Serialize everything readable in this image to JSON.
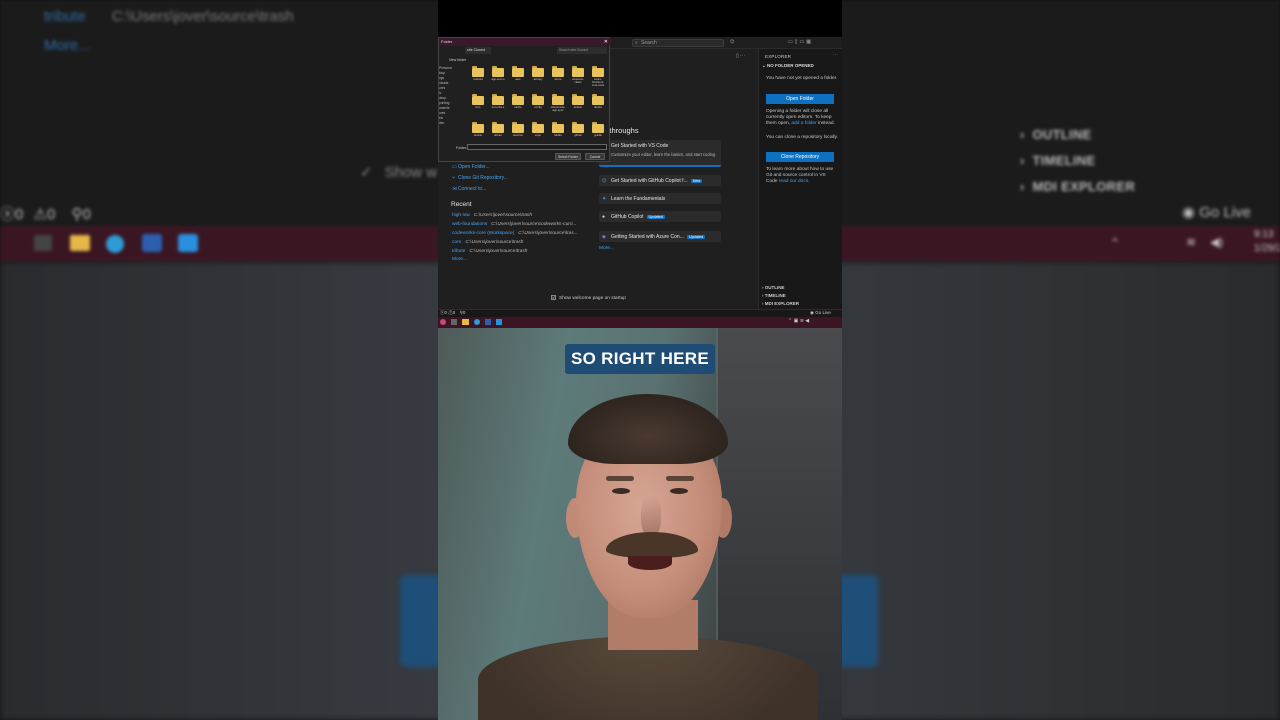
{
  "background": {
    "recent_name": "tribute",
    "recent_path": "C:\\Users\\jover\\source\\trash",
    "more": "More...",
    "show_welcome": "Show w",
    "outline": "OUTLINE",
    "timeline": "TIMELINE",
    "mdi_explorer": "MDI EXPLORER",
    "go_live": "Go Live",
    "errors": "0",
    "warnings": "0",
    "ports": "0",
    "clock_time": "9:13",
    "clock_date": "1/29/2"
  },
  "vscode": {
    "search_placeholder": "Search",
    "explorer_title": "EXPLORER",
    "no_folder": "NO FOLDER OPENED",
    "no_folder_msg": "You have not yet opened a folder.",
    "open_folder_btn": "Open Folder",
    "opening_msg": "Opening a folder will close all currently open editors. To keep them open,",
    "add_folder_link": "add a folder",
    "instead": "instead.",
    "clone_msg": "You can clone a repository locally.",
    "clone_btn": "Clone Repository",
    "learn_msg": "To learn more about how to use Git and source control in VS Code",
    "read_docs": "read our docs.",
    "outline": "OUTLINE",
    "timeline": "TIMELINE",
    "mdi_explorer": "MDI EXPLORER",
    "status_errors": "0",
    "status_warnings": "0",
    "status_ports": "0",
    "go_live": "Go Live"
  },
  "welcome": {
    "start_items": [
      {
        "label": "Open Folder..."
      },
      {
        "label": "Clone Git Repository..."
      },
      {
        "label": "Connect to..."
      }
    ],
    "recent_title": "Recent",
    "recent": [
      {
        "name": "high-low",
        "path": "C:\\Users\\jover\\source\\trash"
      },
      {
        "name": "web-foundations",
        "path": "C:\\Users\\jover\\source\\codeworks-curri..."
      },
      {
        "name": "codeworks-core (Workspace)",
        "path": "C:\\Users\\jover\\source\\tras..."
      },
      {
        "name": "core",
        "path": "C:\\Users\\jover\\source\\trash"
      },
      {
        "name": "tribute",
        "path": "C:\\Users\\jover\\source\\trash"
      }
    ],
    "more": "More...",
    "walkthroughs_title": "lkthroughs",
    "walkthroughs": [
      {
        "title": "Get Started with VS Code",
        "desc": "Customize your editor, learn the basics, and start coding",
        "badge": ""
      },
      {
        "title": "Get Started with GitHub Copilot f...",
        "desc": "",
        "badge": "New"
      },
      {
        "title": "Learn the Fundamentals",
        "desc": "",
        "badge": ""
      },
      {
        "title": "GitHub Copilot",
        "desc": "",
        "badge": "Updated"
      },
      {
        "title": "Getting Started with Azure Con...",
        "desc": "",
        "badge": "Updated"
      }
    ],
    "walk_more": "More...",
    "show_welcome": "Show welcome page on startup"
  },
  "dialog": {
    "title": "Folder",
    "tab": "site Cloned",
    "search": "Search site Cloned",
    "new_folder": "New folder",
    "nav": [
      "Personal",
      "ktop",
      "vgs",
      "nloads",
      "ures",
      "ic",
      "deop",
      "printing",
      "uments",
      "ures",
      "eic",
      "deo"
    ],
    "folders": [
      "android",
      "app-mon-s",
      "aws",
      "azcopy",
      "azure",
      "azuretun-cilans",
      "azure-functions-core-tools",
      "bun",
      "bun-cha-s",
      "cache",
      "config",
      "cloud-code-app-sync",
      "docker",
      "dlocks",
      "docker",
      "dotnet",
      "electron",
      "expo",
      "fiddler",
      "github",
      "gradle"
    ],
    "folder_label": "Folder:",
    "select_btn": "Select Folder",
    "cancel_btn": "Cancel"
  },
  "caption": "SO RIGHT HERE",
  "colors": {
    "accent": "#0e70c0",
    "link": "#4aa3ec",
    "caption_bg": "#1f4c74",
    "taskbar": "#3b1524"
  }
}
